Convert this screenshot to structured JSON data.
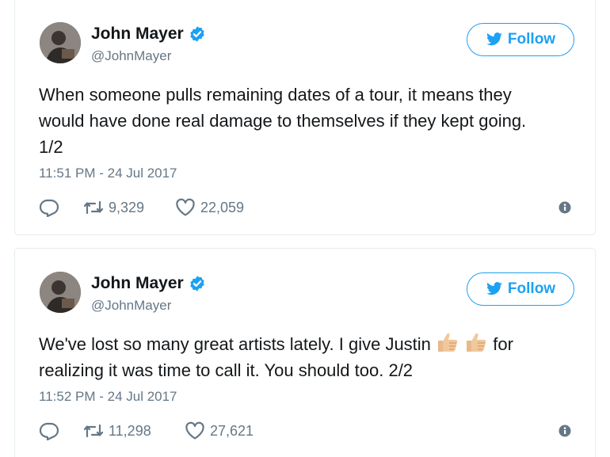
{
  "tweets": [
    {
      "name": "John Mayer",
      "handle": "@JohnMayer",
      "follow_label": "Follow",
      "text_lines": [
        "When someone pulls remaining dates of a tour, it means they",
        "would have done real damage to themselves if they kept going.",
        "1/2"
      ],
      "timestamp": "11:51 PM - 24 Jul 2017",
      "retweets": "9,329",
      "likes": "22,059"
    },
    {
      "name": "John Mayer",
      "handle": "@JohnMayer",
      "follow_label": "Follow",
      "text_before_emoji": "We've lost so many great artists lately. I give Justin",
      "text_after_emoji": "for",
      "text_line2": "realizing it was time to call it. You should too. 2/2",
      "timestamp": "11:52 PM - 24 Jul 2017",
      "retweets": "11,298",
      "likes": "27,621"
    }
  ],
  "colors": {
    "brand": "#1da1f2",
    "secondary_text": "#657786",
    "primary_text": "#14171a"
  },
  "icons": [
    "verified-badge-icon",
    "twitter-bird-icon",
    "reply-icon",
    "retweet-icon",
    "heart-icon",
    "info-icon",
    "thumbs-up-emoji-icon"
  ]
}
